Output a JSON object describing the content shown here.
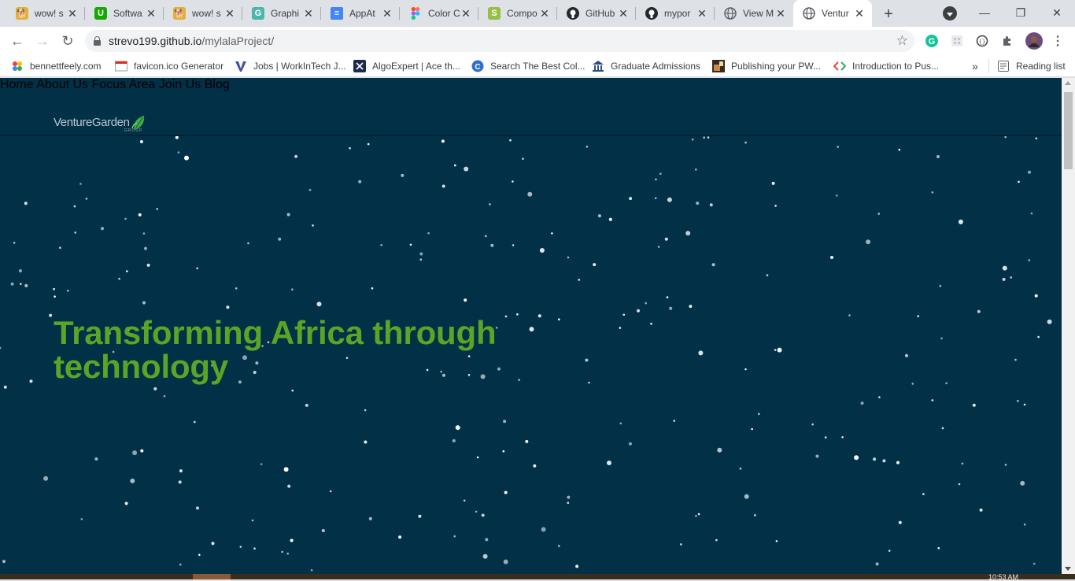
{
  "browser": {
    "tabs": [
      {
        "title": "wow! s",
        "icon": "doge-icon",
        "active": false
      },
      {
        "title": "Softwa",
        "icon": "upwork-icon",
        "active": false
      },
      {
        "title": "wow! s",
        "icon": "doge-icon",
        "active": false
      },
      {
        "title": "Graphi",
        "icon": "graphic-icon",
        "active": false
      },
      {
        "title": "AppAt",
        "icon": "docs-icon",
        "active": false
      },
      {
        "title": "Color C",
        "icon": "figma-icon",
        "active": false
      },
      {
        "title": "Compo",
        "icon": "shopify-icon",
        "active": false
      },
      {
        "title": "GitHub",
        "icon": "github-icon",
        "active": false
      },
      {
        "title": "mypor",
        "icon": "github-icon",
        "active": false
      },
      {
        "title": "View M",
        "icon": "globe-icon",
        "active": false
      },
      {
        "title": "Ventur",
        "icon": "globe-icon",
        "active": true
      }
    ],
    "url_host": "strevo199.github.io",
    "url_path": "/mylalaProject/",
    "bookmarks": [
      {
        "label": "bennettfeely.com",
        "icon": "bennettfeely-icon"
      },
      {
        "label": "favicon.ico Generator",
        "icon": "favicon-generator-icon"
      },
      {
        "label": "Jobs | WorkInTech J...",
        "icon": "workintech-icon"
      },
      {
        "label": "AlgoExpert | Ace th...",
        "icon": "algoexpert-icon"
      },
      {
        "label": "Search The Best Col...",
        "icon": "color-search-icon"
      },
      {
        "label": "Graduate Admissions",
        "icon": "university-icon"
      },
      {
        "label": "Publishing your PW...",
        "icon": "pwa-icon"
      },
      {
        "label": "Introduction to Pus...",
        "icon": "code-icon"
      }
    ],
    "bookmarks_overflow": "»",
    "reading_list": "Reading list",
    "clock": "10:53 AM"
  },
  "site": {
    "logo_text": "VentureGarden",
    "logo_sub": "GROUP",
    "nav": [
      "Home",
      "About Us",
      "Focus Area",
      "Join Us",
      "Blog"
    ],
    "hero_title": "Transforming Africa through technology"
  },
  "colors": {
    "background": "#023047",
    "hero_title": "#5aa526",
    "nav_text": "#ffffff"
  }
}
